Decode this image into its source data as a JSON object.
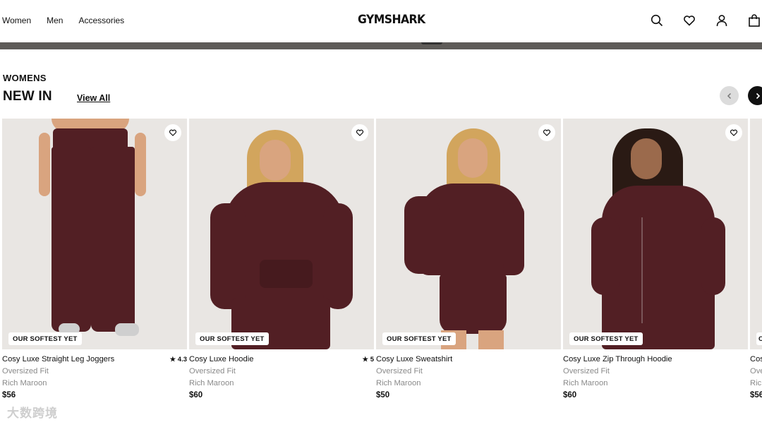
{
  "header": {
    "nav": [
      "Women",
      "Men",
      "Accessories"
    ],
    "logo": "GYMSHARK",
    "icons": [
      "search-icon",
      "wishlist-heart-icon",
      "account-icon",
      "bag-icon"
    ]
  },
  "section": {
    "label": "WOMENS",
    "title": "NEW IN",
    "view_all": "View All"
  },
  "colors": {
    "product_maroon": "#521f24",
    "image_bg": "#e9e6e3",
    "muted_text": "#8a8a8a"
  },
  "products": [
    {
      "badge": "OUR SOFTEST YET",
      "name": "Cosy Luxe Straight Leg Joggers",
      "fit": "Oversized Fit",
      "color": "Rich Maroon",
      "price": "$56",
      "rating": "★ 4.3"
    },
    {
      "badge": "OUR SOFTEST YET",
      "name": "Cosy Luxe Hoodie",
      "fit": "Oversized Fit",
      "color": "Rich Maroon",
      "price": "$60",
      "rating": "★ 5"
    },
    {
      "badge": "OUR SOFTEST YET",
      "name": "Cosy Luxe Sweatshirt",
      "fit": "Oversized Fit",
      "color": "Rich Maroon",
      "price": "$50",
      "rating": ""
    },
    {
      "badge": "OUR SOFTEST YET",
      "name": "Cosy Luxe Zip Through Hoodie",
      "fit": "Oversized Fit",
      "color": "Rich Maroon",
      "price": "$60",
      "rating": ""
    },
    {
      "badge": "O",
      "name": "Cos",
      "fit": "Ove",
      "color": "Ric",
      "price": "$56",
      "rating": ""
    }
  ],
  "watermark": "大数跨境"
}
